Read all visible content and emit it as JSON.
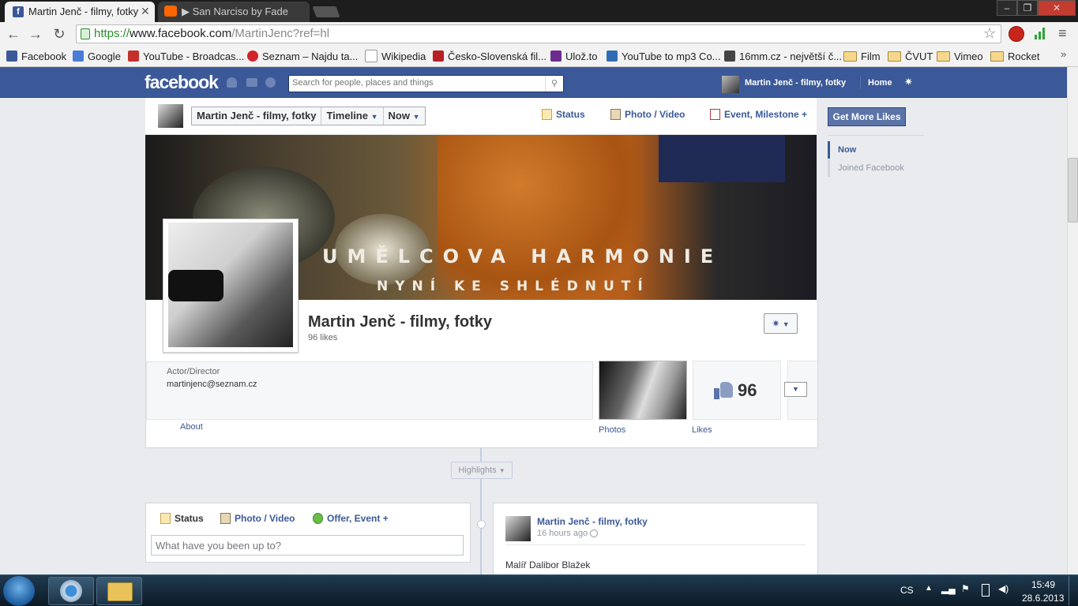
{
  "browser": {
    "tabs": [
      {
        "title": "Martin Jenč - filmy, fotky",
        "active": true
      },
      {
        "title": "▶ San Narciso by Fade",
        "active": false
      }
    ],
    "url_https": "https://",
    "url_domain": "www.facebook.com",
    "url_path": "/MartinJenc?ref=hl",
    "bookmarks": [
      {
        "label": "Facebook"
      },
      {
        "label": "Google"
      },
      {
        "label": "YouTube - Broadcas..."
      },
      {
        "label": "Seznam – Najdu ta..."
      },
      {
        "label": "Wikipedia"
      },
      {
        "label": "Česko-Slovenská fil..."
      },
      {
        "label": "Ulož.to"
      },
      {
        "label": "YouTube to mp3 Co..."
      },
      {
        "label": "16mm.cz - největší č..."
      },
      {
        "label": "Film"
      },
      {
        "label": "ČVUT"
      },
      {
        "label": "Vimeo"
      },
      {
        "label": "Rocket"
      }
    ]
  },
  "fb": {
    "logo": "facebook",
    "search_placeholder": "Search for people, places and things",
    "user_name": "Martin Jenč - filmy, fotky",
    "home": "Home"
  },
  "pagehead": {
    "selector_name": "Martin Jenč - filmy, fotky",
    "selector_timeline": "Timeline",
    "selector_now": "Now",
    "status": "Status",
    "photo_video": "Photo / Video",
    "event_milestone": "Event, Milestone +"
  },
  "cover": {
    "line1": "UMĚLCOVA HARMONIE",
    "line2": "NYNÍ KE SHLÉDNUTÍ"
  },
  "profile": {
    "name": "Martin Jenč - filmy, fotky",
    "likes_text": "96 likes",
    "category": "Actor/Director",
    "email": "martinjenc@seznam.cz",
    "about": "About",
    "photos": "Photos",
    "likes_label": "Likes",
    "likes_count": "96"
  },
  "timeline": {
    "highlights": "Highlights",
    "composer_status": "Status",
    "composer_photo": "Photo / Video",
    "composer_offer": "Offer, Event +",
    "composer_placeholder": "What have you been up to?",
    "post_author": "Martin Jenč - filmy, fotky",
    "post_time": "16 hours ago",
    "post_text": "Malíř Dalibor Blažek"
  },
  "sidebar": {
    "get_more_likes": "Get More Likes",
    "scrub_now": "Now",
    "scrub_joined": "Joined Facebook"
  },
  "taskbar": {
    "lang": "CS",
    "time": "15:49",
    "date": "28.6.2013"
  },
  "colors": {
    "fb_blue": "#3b5998",
    "link_blue": "#3b5998",
    "chrome_bg": "#f2f2f2"
  }
}
